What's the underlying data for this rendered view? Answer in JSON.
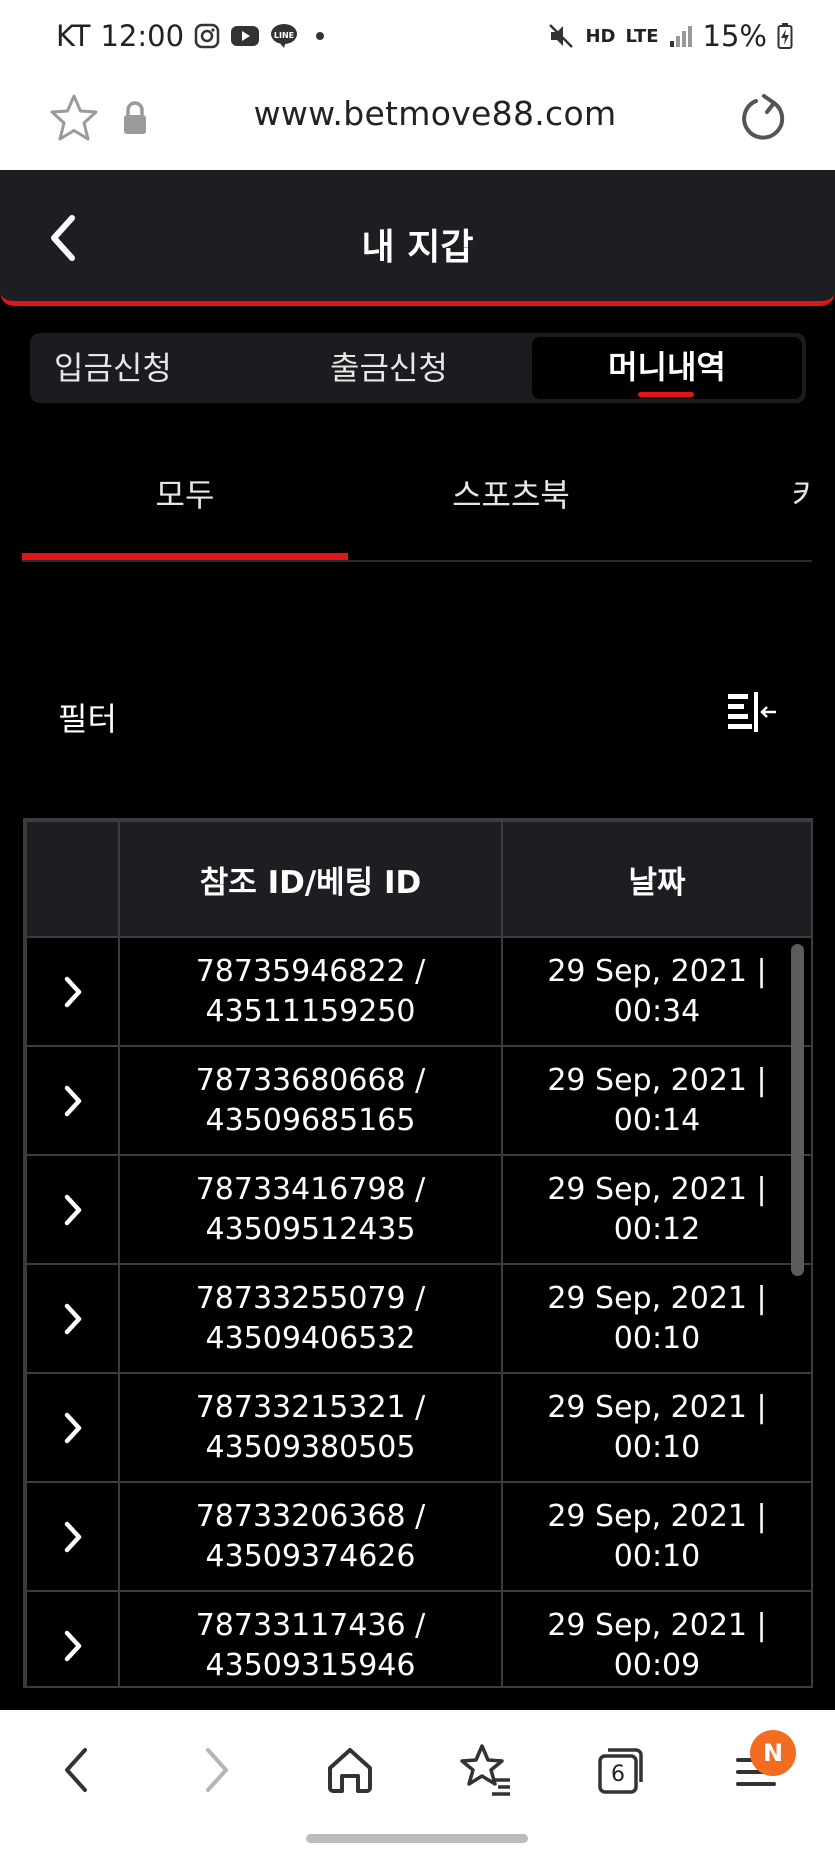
{
  "status_bar": {
    "carrier": "KT",
    "time": "12:00",
    "app_icons": [
      "instagram-icon",
      "youtube-icon",
      "line-icon"
    ],
    "network": "LTE",
    "hd": "HD",
    "battery": "15%"
  },
  "browser": {
    "url": "www.betmove88.com"
  },
  "header": {
    "title": "내 지갑"
  },
  "wallet_tabs": [
    {
      "label": "입금신청"
    },
    {
      "label": "출금신청"
    },
    {
      "label": "머니내역",
      "active": true
    }
  ],
  "sub_tabs": [
    {
      "label": "모두",
      "active": true
    },
    {
      "label": "스포츠북"
    },
    {
      "label": "카"
    }
  ],
  "filter": {
    "label": "필터"
  },
  "table": {
    "columns": [
      "",
      "참조 ID/베팅 ID",
      "날짜"
    ],
    "rows": [
      {
        "ref": "78735946822 /",
        "bet": "43511159250",
        "date": "29 Sep, 2021 |",
        "time": "00:34"
      },
      {
        "ref": "78733680668 /",
        "bet": "43509685165",
        "date": "29 Sep, 2021 |",
        "time": "00:14"
      },
      {
        "ref": "78733416798 /",
        "bet": "43509512435",
        "date": "29 Sep, 2021 |",
        "time": "00:12"
      },
      {
        "ref": "78733255079 /",
        "bet": "43509406532",
        "date": "29 Sep, 2021 |",
        "time": "00:10"
      },
      {
        "ref": "78733215321 /",
        "bet": "43509380505",
        "date": "29 Sep, 2021 |",
        "time": "00:10"
      },
      {
        "ref": "78733206368 /",
        "bet": "43509374626",
        "date": "29 Sep, 2021 |",
        "time": "00:10"
      },
      {
        "ref": "78733117436 /",
        "bet": "43509315946",
        "date": "29 Sep, 2021 |",
        "time": "00:09"
      }
    ]
  },
  "bottom_nav": {
    "tab_count": "6",
    "menu_badge": "N"
  },
  "colors": {
    "accent": "#e31414",
    "header_bg": "#1d1e22",
    "badge": "#f26d21"
  }
}
